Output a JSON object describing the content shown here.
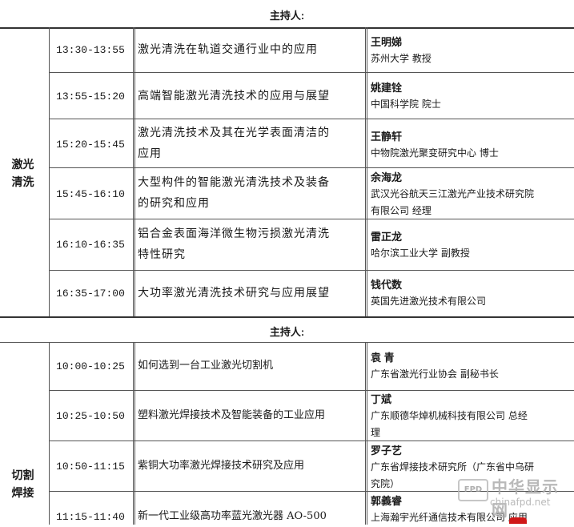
{
  "sections": [
    {
      "host_label": "主持人:",
      "session_lines": [
        "激光",
        "清洗"
      ],
      "rows": [
        {
          "time": "13:30-13:55",
          "topic": [
            "激光清洗在轨道交通行业中的应用"
          ],
          "name": "王明娣",
          "affiliation": [
            "苏州大学  教授"
          ]
        },
        {
          "time": "13:55-15:20",
          "topic": [
            "高端智能激光清洗技术的应用与展望"
          ],
          "name": "姚建铨",
          "affiliation": [
            "中国科学院  院士"
          ]
        },
        {
          "time": "15:20-15:45",
          "topic": [
            "激光清洗技术及其在光学表面清洁的",
            "应用"
          ],
          "name": "王静轩",
          "affiliation": [
            "中物院激光聚变研究中心  博士"
          ]
        },
        {
          "time": "15:45-16:10",
          "topic": [
            "大型构件的智能激光清洗技术及装备",
            "的研究和应用"
          ],
          "name": "余海龙",
          "affiliation": [
            "武汉光谷航天三江激光产业技术研究院",
            "有限公司  经理"
          ]
        },
        {
          "time": "16:10-16:35",
          "topic": [
            "铝合金表面海洋微生物污损激光清洗",
            "特性研究"
          ],
          "name": "雷正龙",
          "affiliation": [
            "哈尔滨工业大学  副教授"
          ]
        },
        {
          "time": "16:35-17:00",
          "topic": [
            "大功率激光清洗技术研究与应用展望"
          ],
          "name": "钱代数",
          "affiliation": [
            "英国先进激光技术有限公司"
          ]
        }
      ]
    },
    {
      "host_label": "主持人:",
      "session_lines": [
        "切割",
        "焊接"
      ],
      "rows": [
        {
          "time": "10:00-10:25",
          "topic": [
            "如何选到一台工业激光切割机"
          ],
          "name": "袁  青",
          "affiliation": [
            "广东省激光行业协会    副秘书长"
          ]
        },
        {
          "time": "10:25-10:50",
          "topic": [
            "塑料激光焊接技术及智能装备的工业应用"
          ],
          "name": "丁斌",
          "affiliation": [
            "广东顺德华焯机械科技有限公司  总经",
            "理"
          ]
        },
        {
          "time": "10:50-11:15",
          "topic": [
            "紫铜大功率激光焊接技术研究及应用"
          ],
          "name": "罗子艺",
          "affiliation": [
            "广东省焊接技术研究所（广东省中乌研",
            "究院）"
          ]
        },
        {
          "time": "11:15-11:40",
          "topic": [
            "新一代工业级高功率蓝光激光器 AO-500"
          ],
          "name": "郭義睿",
          "affiliation": [
            "上海瀚宇光纤通信技术有限公司  应用"
          ]
        }
      ]
    }
  ],
  "watermark": {
    "badge": "FPD",
    "cn_text": "中华显示网",
    "url": "chinafpd.net"
  }
}
